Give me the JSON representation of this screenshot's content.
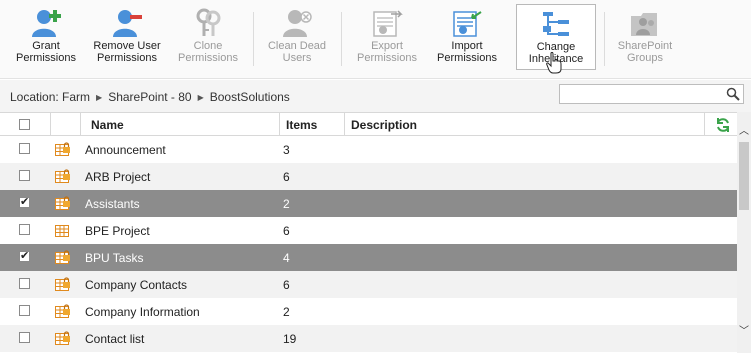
{
  "ribbon": {
    "buttons": [
      {
        "line1": "Grant",
        "line2": "Permissions",
        "enabled": true
      },
      {
        "line1": "Remove User",
        "line2": "Permissions",
        "enabled": true
      },
      {
        "line1": "Clone",
        "line2": "Permissions",
        "enabled": false
      },
      {
        "line1": "Clean Dead",
        "line2": "Users",
        "enabled": false
      },
      {
        "line1": "Export",
        "line2": "Permissions",
        "enabled": false
      },
      {
        "line1": "Import",
        "line2": "Permissions",
        "enabled": true
      },
      {
        "line1": "Change",
        "line2": "Inheritance",
        "enabled": true,
        "active": true
      },
      {
        "line1": "SharePoint",
        "line2": "Groups",
        "enabled": false
      }
    ]
  },
  "location": {
    "label": "Location:",
    "path": [
      "Farm",
      "SharePoint - 80",
      "BoostSolutions"
    ]
  },
  "search": {
    "placeholder": ""
  },
  "grid": {
    "headers": {
      "name": "Name",
      "items": "Items",
      "description": "Description"
    },
    "rows": [
      {
        "name": "Announcement",
        "items": "3",
        "checked": false
      },
      {
        "name": "ARB Project",
        "items": "6",
        "checked": false
      },
      {
        "name": "Assistants",
        "items": "2",
        "checked": true
      },
      {
        "name": "BPE Project",
        "items": "6",
        "checked": false
      },
      {
        "name": "BPU Tasks",
        "items": "4",
        "checked": true
      },
      {
        "name": "Company Contacts",
        "items": "6",
        "checked": false
      },
      {
        "name": "Company Information",
        "items": "2",
        "checked": false
      },
      {
        "name": "Contact list",
        "items": "19",
        "checked": false
      }
    ]
  },
  "colors": {
    "accent": "#3a8fd6",
    "selected_row": "#8c8c8c",
    "refresh": "#3aa34a"
  }
}
